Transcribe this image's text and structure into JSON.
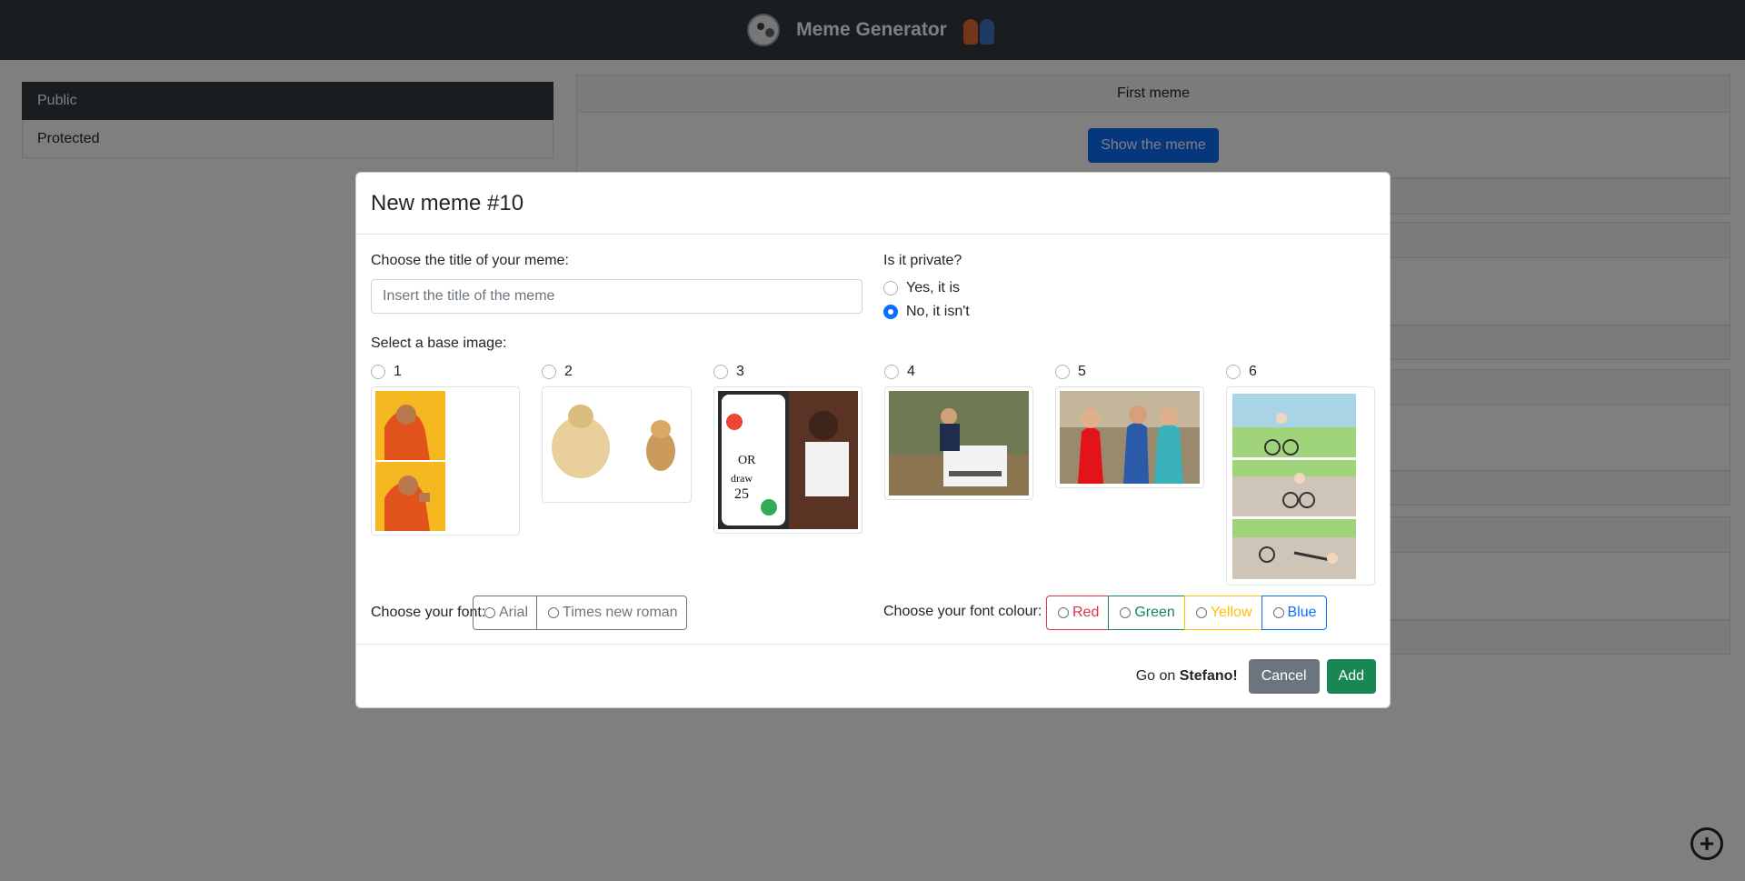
{
  "navbar": {
    "title": "Meme Generator"
  },
  "sidebar": {
    "items": [
      {
        "label": "Public",
        "active": true
      },
      {
        "label": "Protected",
        "active": false
      }
    ]
  },
  "main": {
    "card_title": "First meme",
    "show_button": "Show the meme"
  },
  "modal": {
    "title": "New meme #10",
    "title_label": "Choose the title of your meme:",
    "title_placeholder": "Insert the title of the meme",
    "title_value": "",
    "private_label": "Is it private?",
    "private_options": [
      {
        "label": "Yes, it is",
        "checked": false
      },
      {
        "label": "No, it isn't",
        "checked": true
      }
    ],
    "base_image_label": "Select a base image:",
    "images": [
      {
        "label": "1"
      },
      {
        "label": "2"
      },
      {
        "label": "3"
      },
      {
        "label": "4"
      },
      {
        "label": "5"
      },
      {
        "label": "6"
      }
    ],
    "font_label": "Choose your font:",
    "fonts": [
      "Arial",
      "Times new roman"
    ],
    "colour_label": "Choose your font colour:",
    "colours": [
      {
        "label": "Red",
        "color": "#dc3545"
      },
      {
        "label": "Green",
        "color": "#198754"
      },
      {
        "label": "Yellow",
        "color": "#ffc107"
      },
      {
        "label": "Blue",
        "color": "#0d6efd"
      }
    ],
    "footer": {
      "prefix": "Go on ",
      "user": "Stefano!",
      "cancel": "Cancel",
      "add": "Add"
    }
  },
  "fab": {
    "icon": "plus-circle-icon"
  },
  "colors": {
    "navbar": "#343a40",
    "primary": "#0d6efd",
    "secondary": "#6c757d",
    "success": "#198754"
  }
}
